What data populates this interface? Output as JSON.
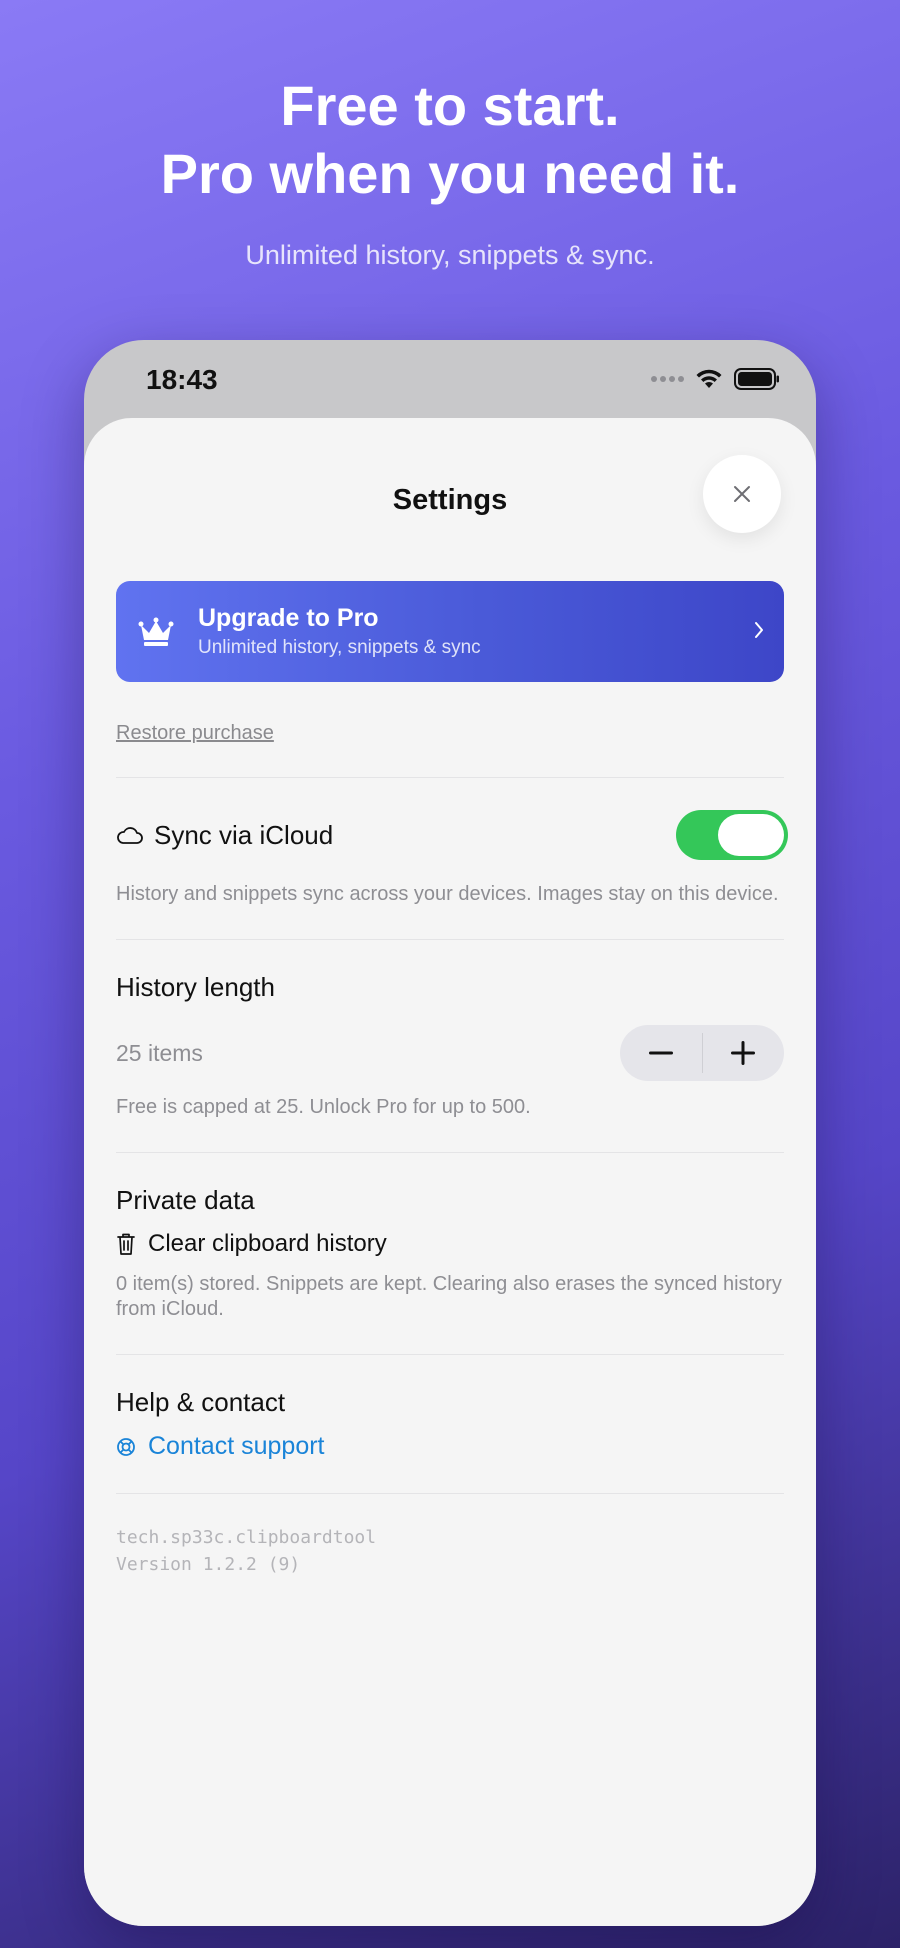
{
  "hero": {
    "title_line1": "Free to start.",
    "title_line2": "Pro when you need it.",
    "subtitle": "Unlimited history, snippets & sync."
  },
  "status_bar": {
    "time": "18:43",
    "icons": [
      "signal-dots-icon",
      "wifi-icon",
      "battery-icon"
    ]
  },
  "settings": {
    "title": "Settings",
    "close_icon": "close-icon",
    "upgrade": {
      "icon": "crown-icon",
      "title": "Upgrade to Pro",
      "subtitle": "Unlimited history, snippets & sync",
      "chevron": "chevron-right-icon"
    },
    "restore_label": "Restore purchase",
    "sync": {
      "icon": "cloud-icon",
      "title": "Sync via iCloud",
      "enabled": true,
      "caption": "History and snippets sync across your devices. Images stay on this device."
    },
    "history": {
      "title": "History length",
      "value": "25 items",
      "minus_label": "−",
      "plus_label": "+",
      "caption": "Free is capped at 25. Unlock Pro for up to 500."
    },
    "private_data": {
      "title": "Private data",
      "icon": "trash-icon",
      "action_label": "Clear clipboard history",
      "caption": "0 item(s) stored. Snippets are kept. Clearing also erases the synced history from iCloud."
    },
    "help": {
      "title": "Help & contact",
      "icon": "lifebuoy-icon",
      "link_label": "Contact support"
    },
    "footer": {
      "bundle_id": "tech.sp33c.clipboardtool",
      "version": "Version 1.2.2 (9)"
    }
  },
  "colors": {
    "accent_blue": "#1a84d8",
    "toggle_on": "#34c759",
    "banner_start": "#6073f0",
    "banner_end": "#3d46c8"
  }
}
